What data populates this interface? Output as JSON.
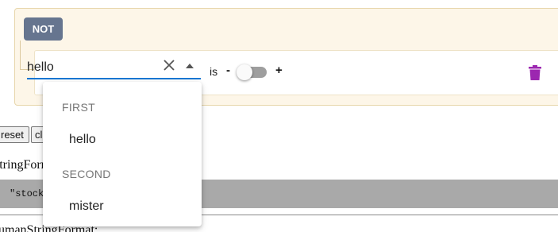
{
  "group": {
    "not_label": "NOT"
  },
  "rule": {
    "field_value": "hello",
    "operator_label": "is",
    "minus_label": "-",
    "plus_label": "+",
    "toggle_on": false,
    "icons": [
      "close-icon",
      "arrow-up-icon",
      "delete-icon"
    ],
    "delete_color": "#9c27b0"
  },
  "dropdown": {
    "groups": [
      {
        "header": "FIRST",
        "options": [
          "hello"
        ]
      },
      {
        "header": "SECOND",
        "options": [
          "mister"
        ]
      }
    ]
  },
  "background": {
    "reset_label": "reset",
    "cl_label": "cl",
    "string_format_label": "stringForm",
    "code_text": "\"stock",
    "human_string_format_label": "humanStringFormat:"
  },
  "colors": {
    "focus_underline": "#1976d2",
    "not_button": "#66758f",
    "group_bg": "#fdf6e8"
  }
}
